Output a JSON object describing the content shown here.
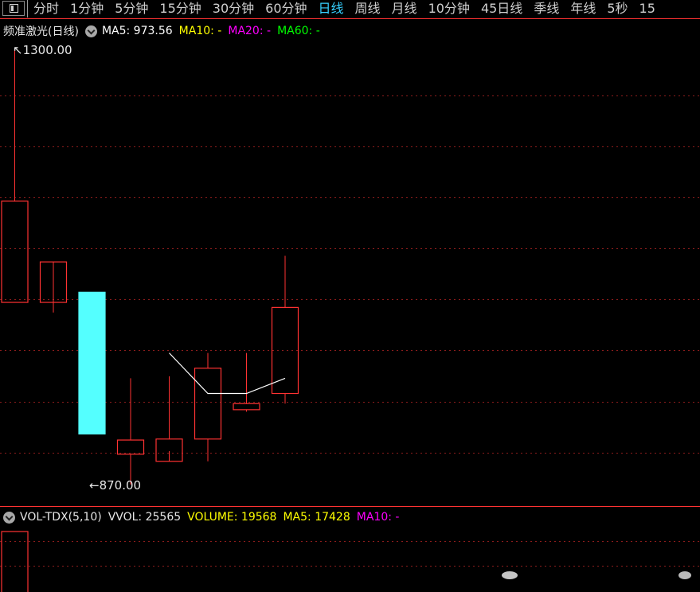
{
  "toolbar": {
    "tabs": [
      {
        "label": "分时",
        "active": false
      },
      {
        "label": "1分钟",
        "active": false
      },
      {
        "label": "5分钟",
        "active": false
      },
      {
        "label": "15分钟",
        "active": false
      },
      {
        "label": "30分钟",
        "active": false
      },
      {
        "label": "60分钟",
        "active": false
      },
      {
        "label": "日线",
        "active": true
      },
      {
        "label": "周线",
        "active": false
      },
      {
        "label": "月线",
        "active": false
      },
      {
        "label": "10分钟",
        "active": false
      },
      {
        "label": "45日线",
        "active": false
      },
      {
        "label": "季线",
        "active": false
      },
      {
        "label": "年线",
        "active": false
      },
      {
        "label": "5秒",
        "active": false
      },
      {
        "label": "15",
        "active": false
      }
    ]
  },
  "price_legend": {
    "title": "频准激光(日线)",
    "ma5": "MA5: 973.56",
    "ma10": "MA10: -",
    "ma20": "MA20: -",
    "ma60": "MA60: -"
  },
  "volume_legend": {
    "name": "VOL-TDX(5,10)",
    "vvol": "VVOL: 25565",
    "volume": "VOLUME: 19568",
    "ma5": "MA5: 17428",
    "ma10": "MA10: -"
  },
  "colors": {
    "up": "#ff3232",
    "down": "#54ffff",
    "grid": "#8c1c1c",
    "text": "#e6e6e6",
    "ma5": "#ffffff",
    "ma10": "#ffff00",
    "ma20": "#ff00ff",
    "ma60": "#00ff00",
    "active_tab": "#36d0ff"
  },
  "chart_data": {
    "type": "candlestick",
    "period": "日线",
    "ylim": [
      870.0,
      1300.0
    ],
    "max_label": "1300.00",
    "min_label": "870.00",
    "candles": [
      {
        "open": 1050.0,
        "close": 1150.0,
        "high": 1300.0,
        "low": 1050.0
      },
      {
        "open": 1050.0,
        "close": 1090.0,
        "high": 1040.0,
        "low": 1041.0
      },
      {
        "open": 1060.0,
        "close": 920.0,
        "high": 1060.0,
        "low": 920.0
      },
      {
        "open": 900.0,
        "close": 914.0,
        "high": 975.0,
        "low": 870.0
      },
      {
        "open": 893.0,
        "close": 915.0,
        "high": 977.0,
        "low": 903.0
      },
      {
        "open": 915.0,
        "close": 985.0,
        "high": 1000.0,
        "low": 893.0
      },
      {
        "open": 944.0,
        "close": 950.0,
        "high": 1000.0,
        "low": 942.0
      },
      {
        "open": 960.0,
        "close": 1045.0,
        "high": 1096.0,
        "low": 950.0
      }
    ],
    "ma5_line": [
      null,
      null,
      null,
      null,
      1000.0,
      960.0,
      960.0,
      975.0
    ],
    "volume": {
      "vvol": 25565,
      "volume": 19568,
      "ma5": 17428
    }
  }
}
